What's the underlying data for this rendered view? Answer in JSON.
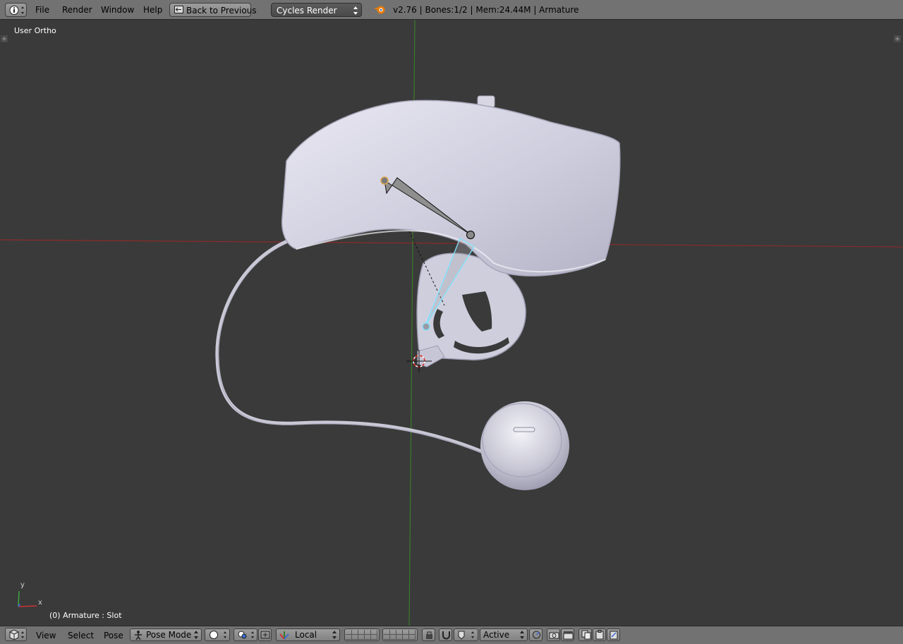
{
  "topbar": {
    "info_icon": "info-icon",
    "menus": [
      "File",
      "Render",
      "Window",
      "Help"
    ],
    "back_button": "Back to Previous",
    "render_engine": "Cycles Render",
    "stats": "v2.76 | Bones:1/2  | Mem:24.44M | Armature"
  },
  "viewport": {
    "view_label": "User Ortho",
    "object_label": "(0) Armature : Slot",
    "axis_x": "x",
    "axis_y": "y"
  },
  "bottombar": {
    "menus": [
      "View",
      "Select",
      "Pose"
    ],
    "mode": "Pose Mode",
    "orientation": "Local",
    "pivot_mode": "Active"
  },
  "colors": {
    "header_bg": "#727272",
    "viewport_bg": "#3a3a3a",
    "active_bone": "#7fe5ff",
    "x_axis": "#8c2a2a",
    "y_axis": "#3a7a2a"
  }
}
